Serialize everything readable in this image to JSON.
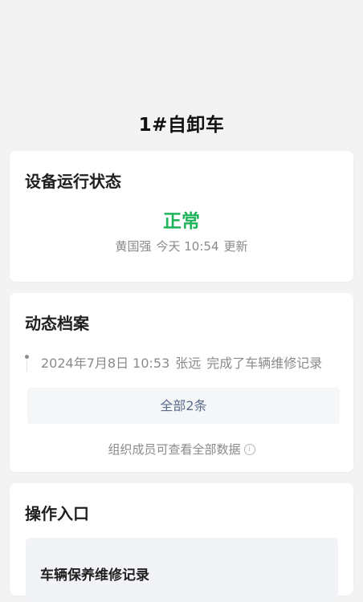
{
  "header": {
    "title": "1#自卸车"
  },
  "status_card": {
    "title": "设备运行状态",
    "status": "正常",
    "status_color": "#1fb45b",
    "updated_by": "黄国强",
    "updated_time": "今天 10:54",
    "updated_suffix": "更新"
  },
  "archive_card": {
    "title": "动态档案",
    "records": [
      {
        "datetime": "2024年7月8日 10:53",
        "user": "张远",
        "action": "完成了车辆维修记录"
      }
    ],
    "all_button_label": "全部2条",
    "org_note": "组织成员可查看全部数据",
    "info_icon": "info-icon"
  },
  "ops_card": {
    "title": "操作入口",
    "entry_label": "车辆保养维修记录"
  }
}
